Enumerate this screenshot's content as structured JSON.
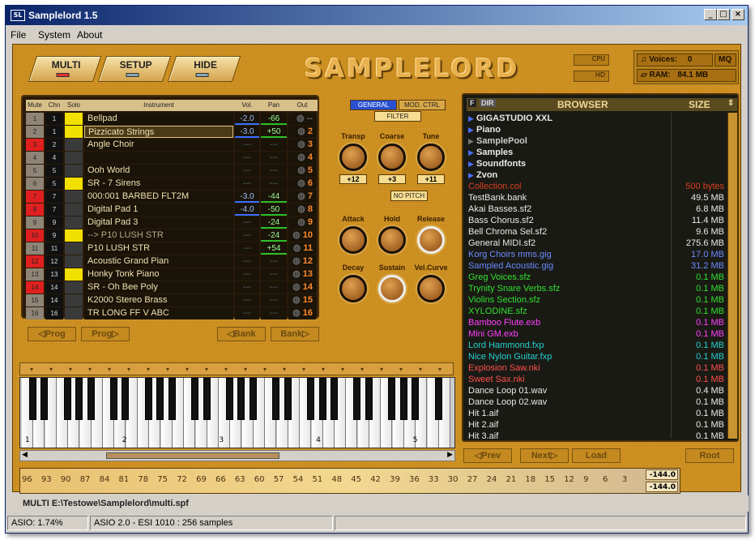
{
  "window": {
    "title": "Samplelord 1.5",
    "logo": "SL"
  },
  "menu": [
    "File",
    "System",
    "About"
  ],
  "tabs": [
    {
      "label": "MULTI",
      "active": true
    },
    {
      "label": "SETUP",
      "active": false
    },
    {
      "label": "HIDE",
      "active": false
    }
  ],
  "brand": "SAMPLELORD",
  "indicators": {
    "cpu": "CPU",
    "hd": "HD"
  },
  "voices": {
    "label": "Voices:",
    "value": "0",
    "mq": "MQ",
    "ram_label": "RAM:",
    "ram_value": "84.1 MB"
  },
  "mixer": {
    "headers": {
      "mute": "Mute",
      "chn": "Chn",
      "solo": "Solo",
      "instrument": "Instrument",
      "vol": "Vol.",
      "pan": "Pan",
      "out": "Out"
    },
    "rows": [
      {
        "mute": "1",
        "muted": false,
        "chn": "1",
        "solo": true,
        "name": "Bellpad",
        "vol": "-2.0",
        "pan": "-66",
        "out": "--"
      },
      {
        "mute": "2",
        "muted": false,
        "chn": "1",
        "solo": true,
        "name": "Pizzicato Strings",
        "vol": "-3.0",
        "pan": "+50",
        "out": "2",
        "selected": true
      },
      {
        "mute": "3",
        "muted": true,
        "chn": "2",
        "solo": false,
        "name": "Angle Choir",
        "vol": "---",
        "pan": "---",
        "out": "3"
      },
      {
        "mute": "4",
        "muted": false,
        "chn": "4",
        "solo": false,
        "name": "",
        "vol": "---",
        "pan": "---",
        "out": "4"
      },
      {
        "mute": "5",
        "muted": false,
        "chn": "5",
        "solo": false,
        "name": "Ooh World",
        "vol": "---",
        "pan": "---",
        "out": "5"
      },
      {
        "mute": "6",
        "muted": false,
        "chn": "5",
        "solo": true,
        "name": "SR - 7 Sirens",
        "vol": "---",
        "pan": "---",
        "out": "6"
      },
      {
        "mute": "7",
        "muted": true,
        "chn": "7",
        "solo": false,
        "name": "000:001  BARBED FLT2M",
        "vol": "-3.0",
        "pan": "-44",
        "out": "7"
      },
      {
        "mute": "8",
        "muted": true,
        "chn": "7",
        "solo": false,
        "name": "Digital Pad 1",
        "vol": "-4.0",
        "pan": "-50",
        "out": "8"
      },
      {
        "mute": "9",
        "muted": false,
        "chn": "9",
        "solo": false,
        "name": "Digital Pad 3",
        "vol": "---",
        "pan": "-24",
        "out": "9"
      },
      {
        "mute": "10",
        "muted": true,
        "chn": "9",
        "solo": true,
        "name": "--> P10 LUSH STR",
        "vol": "---",
        "pan": "-24",
        "out": "10",
        "dim": true
      },
      {
        "mute": "11",
        "muted": false,
        "chn": "11",
        "solo": false,
        "name": "P10 LUSH STR",
        "vol": "---",
        "pan": "+54",
        "out": "11"
      },
      {
        "mute": "12",
        "muted": true,
        "chn": "12",
        "solo": false,
        "name": "Acoustic Grand Pian",
        "vol": "---",
        "pan": "---",
        "out": "12"
      },
      {
        "mute": "13",
        "muted": false,
        "chn": "13",
        "solo": true,
        "name": "Honky Tonk Piano",
        "vol": "---",
        "pan": "---",
        "out": "13"
      },
      {
        "mute": "14",
        "muted": true,
        "chn": "14",
        "solo": false,
        "name": "SR - Oh Bee Poly",
        "vol": "---",
        "pan": "---",
        "out": "14"
      },
      {
        "mute": "15",
        "muted": false,
        "chn": "14",
        "solo": false,
        "name": "K2000 Stereo Brass",
        "vol": "---",
        "pan": "---",
        "out": "15"
      },
      {
        "mute": "16",
        "muted": false,
        "chn": "16",
        "solo": false,
        "name": "TR LONG FF V ABC",
        "vol": "---",
        "pan": "---",
        "out": "16"
      }
    ]
  },
  "nav": {
    "prog_prev": "Prog",
    "prog_next": "Prog",
    "bank_prev": "Bank",
    "bank_next": "Bank"
  },
  "params": {
    "general": "GENERAL",
    "mod": "MOD. CTRL",
    "filter": "FILTER",
    "nopitch": "NO PITCH",
    "knobs_top": [
      {
        "label": "Transp",
        "value": "+12"
      },
      {
        "label": "Coarse",
        "value": "+3"
      },
      {
        "label": "Tune",
        "value": "+11"
      }
    ],
    "knobs_mid": [
      {
        "label": "Attack"
      },
      {
        "label": "Hold"
      },
      {
        "label": "Release"
      }
    ],
    "knobs_bot": [
      {
        "label": "Decay"
      },
      {
        "label": "Sustain"
      },
      {
        "label": "Vel.Curve"
      }
    ]
  },
  "browser": {
    "f": "F",
    "dir": "DIR",
    "title": "BROWSER",
    "size": "SIZE",
    "items": [
      {
        "name": "GIGASTUDIO XXL",
        "size": "",
        "type": "folder",
        "color": "#e8e8e8"
      },
      {
        "name": "Piano",
        "size": "",
        "type": "folder",
        "color": "#e8e8e8"
      },
      {
        "name": "SamplePool",
        "size": "",
        "type": "folder-empty",
        "color": "#cccccc"
      },
      {
        "name": "Samples",
        "size": "",
        "type": "folder",
        "color": "#e8e8e8"
      },
      {
        "name": "Soundfonts",
        "size": "",
        "type": "folder",
        "color": "#e8e8e8"
      },
      {
        "name": "Zvon",
        "size": "",
        "type": "folder",
        "color": "#e8e8e8"
      },
      {
        "name": "Collection.col",
        "size": "500 bytes",
        "type": "file",
        "color": "#d84020"
      },
      {
        "name": "TestBank.bank",
        "size": "49.5 MB",
        "type": "file",
        "color": "#e8e8e8"
      },
      {
        "name": "Akai Basses.sf2",
        "size": "6.8 MB",
        "type": "file",
        "color": "#e8e8e8"
      },
      {
        "name": "Bass Chorus.sf2",
        "size": "11.4 MB",
        "type": "file",
        "color": "#e8e8e8"
      },
      {
        "name": "Bell Chroma Sel.sf2",
        "size": "9.6 MB",
        "type": "file",
        "color": "#e8e8e8"
      },
      {
        "name": "General MIDI.sf2",
        "size": "275.6 MB",
        "type": "file",
        "color": "#e8e8e8"
      },
      {
        "name": "Korg Choirs mms.gig",
        "size": "17.0 MB",
        "type": "file",
        "color": "#6a8aff"
      },
      {
        "name": "Sampled Acoustic.gig",
        "size": "31.2 MB",
        "type": "file",
        "color": "#6a8aff"
      },
      {
        "name": "Greg Voices.sfz",
        "size": "0.1 MB",
        "type": "file",
        "color": "#30e030"
      },
      {
        "name": "Trynity Snare Verbs.sfz",
        "size": "0.1 MB",
        "type": "file",
        "color": "#30e030"
      },
      {
        "name": "Violins Section.sfz",
        "size": "0.1 MB",
        "type": "file",
        "color": "#30e030"
      },
      {
        "name": "XYLODINE.sfz",
        "size": "0.1 MB",
        "type": "file",
        "color": "#30e030"
      },
      {
        "name": "Bamboo Flute.exb",
        "size": "0.1 MB",
        "type": "file",
        "color": "#ff40ff"
      },
      {
        "name": "Mini GM.exb",
        "size": "0.1 MB",
        "type": "file",
        "color": "#ff40ff"
      },
      {
        "name": "Lord Hammond.fxp",
        "size": "0.1 MB",
        "type": "file",
        "color": "#20d0d0"
      },
      {
        "name": "Nice Nylon Guitar.fxp",
        "size": "0.1 MB",
        "type": "file",
        "color": "#20d0d0"
      },
      {
        "name": "Explosion Saw.nki",
        "size": "0.1 MB",
        "type": "file",
        "color": "#ff5050"
      },
      {
        "name": "Sweet Sax.nki",
        "size": "0.1 MB",
        "type": "file",
        "color": "#ff5050"
      },
      {
        "name": "Dance Loop 01.wav",
        "size": "0.4 MB",
        "type": "file",
        "color": "#e8e8e8"
      },
      {
        "name": "Dance Loop 02.wav",
        "size": "0.1 MB",
        "type": "file",
        "color": "#e8e8e8"
      },
      {
        "name": "Hit 1.aif",
        "size": "0.1 MB",
        "type": "file",
        "color": "#e8e8e8"
      },
      {
        "name": "Hit 2.aif",
        "size": "0.1 MB",
        "type": "file",
        "color": "#e8e8e8"
      },
      {
        "name": "Hit 3.aif",
        "size": "0.1 MB",
        "type": "file",
        "color": "#e8e8e8"
      }
    ],
    "prev": "Prev",
    "next": "Next",
    "load": "Load",
    "root": "Root"
  },
  "keyboard": {
    "octaves": [
      "1",
      "2",
      "3",
      "4",
      "5"
    ]
  },
  "meter": {
    "scale": [
      "96",
      "93",
      "90",
      "87",
      "84",
      "81",
      "78",
      "75",
      "72",
      "69",
      "66",
      "63",
      "60",
      "57",
      "54",
      "51",
      "48",
      "45",
      "42",
      "39",
      "36",
      "33",
      "30",
      "27",
      "24",
      "21",
      "18",
      "15",
      "12",
      "9",
      "6",
      "3"
    ],
    "left": "-144.0",
    "right": "-144.0"
  },
  "path": "MULTI  E:\\Testowe\\Samplelord\\multi.spf",
  "statusbar": {
    "asio": "ASIO: 1.74%",
    "device": "ASIO 2.0 - ESI 1010 : 256 samples"
  }
}
